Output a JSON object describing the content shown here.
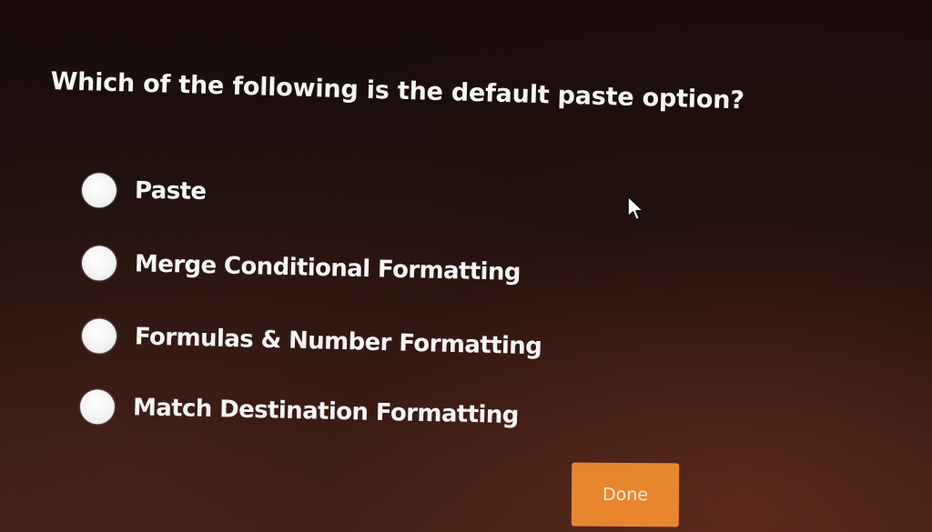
{
  "question": "Which of the following is the default paste option?",
  "options": [
    {
      "label": "Paste",
      "selected": false
    },
    {
      "label": "Merge Conditional Formatting",
      "selected": false
    },
    {
      "label": "Formulas & Number Formatting",
      "selected": false
    },
    {
      "label": "Match Destination Formatting",
      "selected": false
    }
  ],
  "done_label": "Done",
  "colors": {
    "button": "#e8862f",
    "background": "#1c0f0d",
    "text": "#f5f5f5",
    "radio": "#f2f2f2"
  },
  "icons": {
    "cursor": "mouse-pointer-icon"
  }
}
